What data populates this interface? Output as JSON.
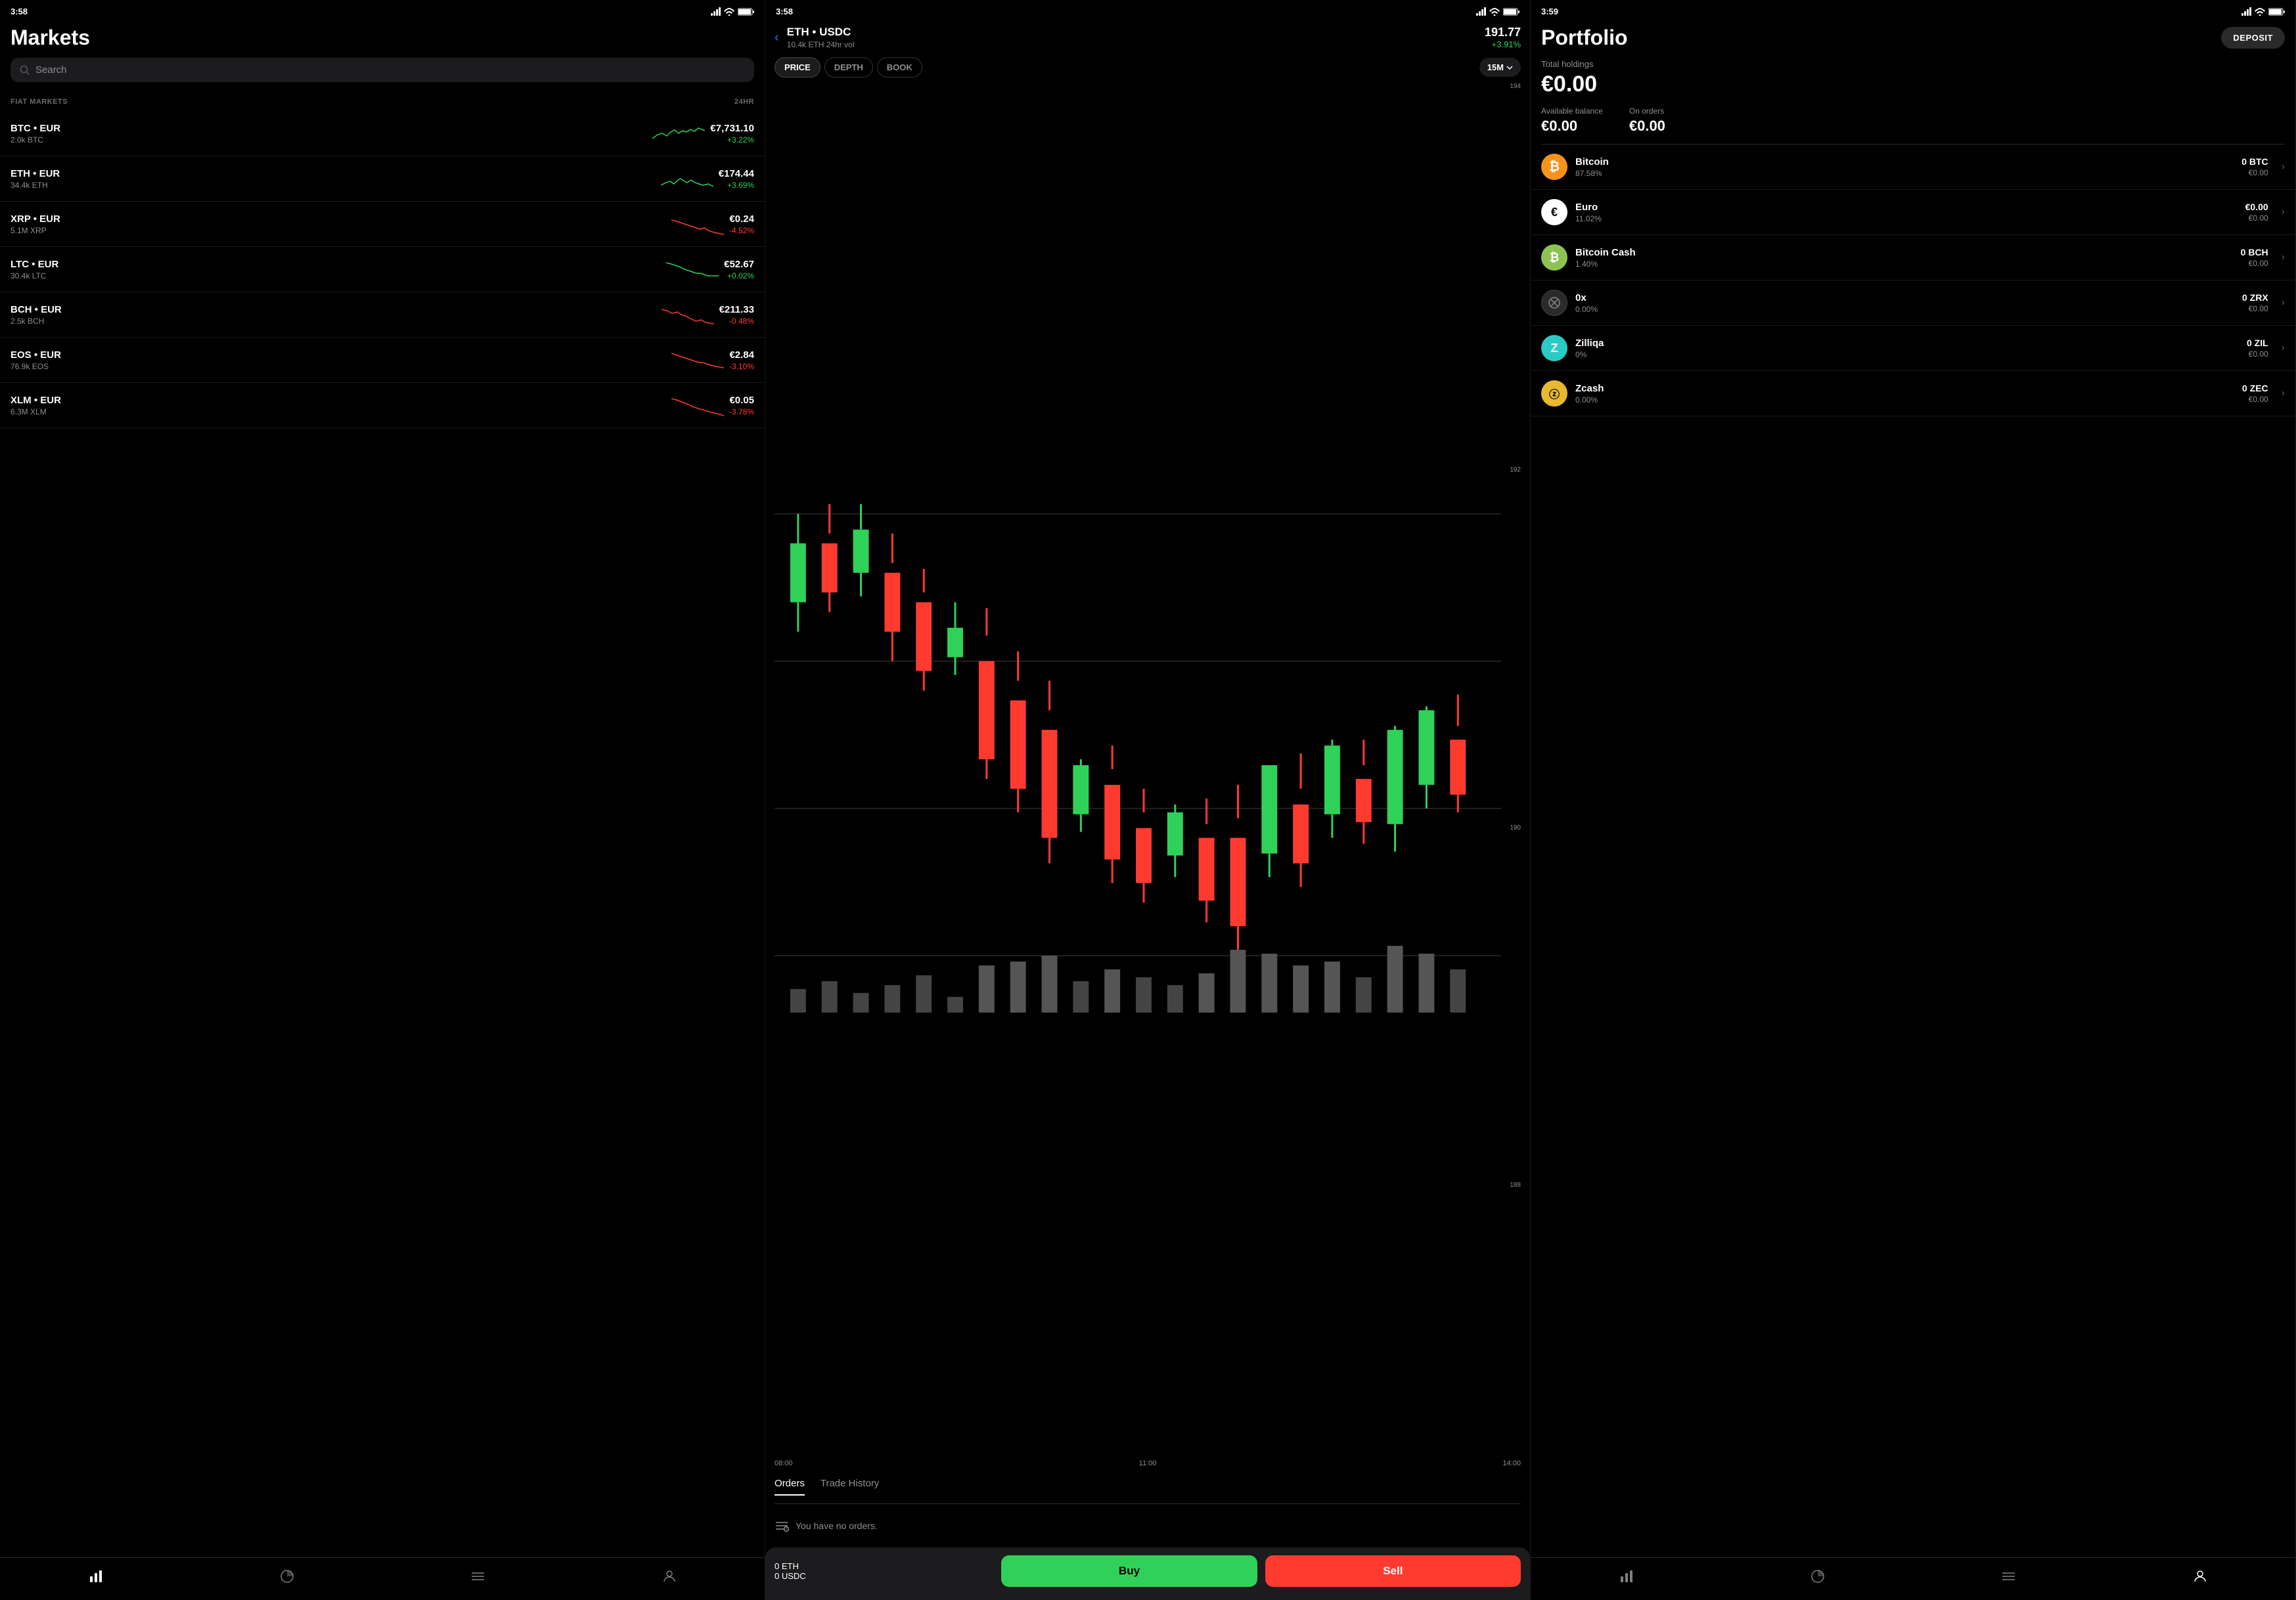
{
  "panels": {
    "markets": {
      "status_time": "3:58",
      "title": "Markets",
      "search_placeholder": "Search",
      "section_label": "FIAT MARKETS",
      "section_24hr": "24HR",
      "items": [
        {
          "pair": "BTC • EUR",
          "vol": "2.0k BTC",
          "price": "€7,731.10",
          "change": "+3.22%",
          "positive": true
        },
        {
          "pair": "ETH • EUR",
          "vol": "34.4k ETH",
          "price": "€174.44",
          "change": "+3.69%",
          "positive": true
        },
        {
          "pair": "XRP • EUR",
          "vol": "5.1M XRP",
          "price": "€0.24",
          "change": "-4.52%",
          "positive": false
        },
        {
          "pair": "LTC • EUR",
          "vol": "30.4k LTC",
          "price": "€52.67",
          "change": "+0.02%",
          "positive": true
        },
        {
          "pair": "BCH • EUR",
          "vol": "2.5k BCH",
          "price": "€211.33",
          "change": "-0.48%",
          "positive": false
        },
        {
          "pair": "EOS • EUR",
          "vol": "76.9k EOS",
          "price": "€2.84",
          "change": "-3.10%",
          "positive": false
        },
        {
          "pair": "XLM • EUR",
          "vol": "6.3M XLM",
          "price": "€0.05",
          "change": "-3.78%",
          "positive": false
        }
      ],
      "nav_items": [
        "chart-bar",
        "pie-chart",
        "list",
        "person"
      ]
    },
    "chart": {
      "status_time": "3:58",
      "pair": "ETH • USDC",
      "vol": "10.4k ETH 24hr vol",
      "price": "191.77",
      "change": "+3.91%",
      "tabs": [
        "PRICE",
        "DEPTH",
        "BOOK"
      ],
      "active_tab": "PRICE",
      "time_selector": "15M",
      "price_labels": [
        "194",
        "192",
        "190",
        "188"
      ],
      "time_labels": [
        "08:00",
        "11:00",
        "14:00"
      ],
      "orders_tabs": [
        "Orders",
        "Trade History"
      ],
      "no_orders_text": "You have no orders.",
      "eth_balance": "0 ETH",
      "usdc_balance": "0 USDC",
      "buy_label": "Buy",
      "sell_label": "Sell"
    },
    "portfolio": {
      "status_time": "3:59",
      "title": "Portfolio",
      "deposit_label": "DEPOSIT",
      "total_label": "Total holdings",
      "total_value": "€0.00",
      "available_label": "Available balance",
      "available_value": "€0.00",
      "orders_label": "On orders",
      "orders_value": "€0.00",
      "assets": [
        {
          "name": "Bitcoin",
          "pct": "87.58%",
          "crypto": "0 BTC",
          "fiat": "€0.00",
          "color": "#f7931a",
          "symbol": "₿",
          "text_color": "#fff"
        },
        {
          "name": "Euro",
          "pct": "11.02%",
          "crypto": "€0.00",
          "fiat": "€0.00",
          "color": "#fff",
          "symbol": "€",
          "text_color": "#000"
        },
        {
          "name": "Bitcoin Cash",
          "pct": "1.40%",
          "crypto": "0 BCH",
          "fiat": "€0.00",
          "color": "#8dc351",
          "symbol": "₿",
          "text_color": "#fff"
        },
        {
          "name": "0x",
          "pct": "0.00%",
          "crypto": "0 ZRX",
          "fiat": "€0.00",
          "color": "#333",
          "symbol": "⊗",
          "text_color": "#fff"
        },
        {
          "name": "Zilliqa",
          "pct": "0%",
          "crypto": "0 ZIL",
          "fiat": "€0.00",
          "color": "#29ccc4",
          "symbol": "Z",
          "text_color": "#fff"
        },
        {
          "name": "Zcash",
          "pct": "0.00%",
          "crypto": "0 ZEC",
          "fiat": "€0.00",
          "color": "#e8b830",
          "symbol": "ⓩ",
          "text_color": "#000"
        }
      ]
    }
  }
}
